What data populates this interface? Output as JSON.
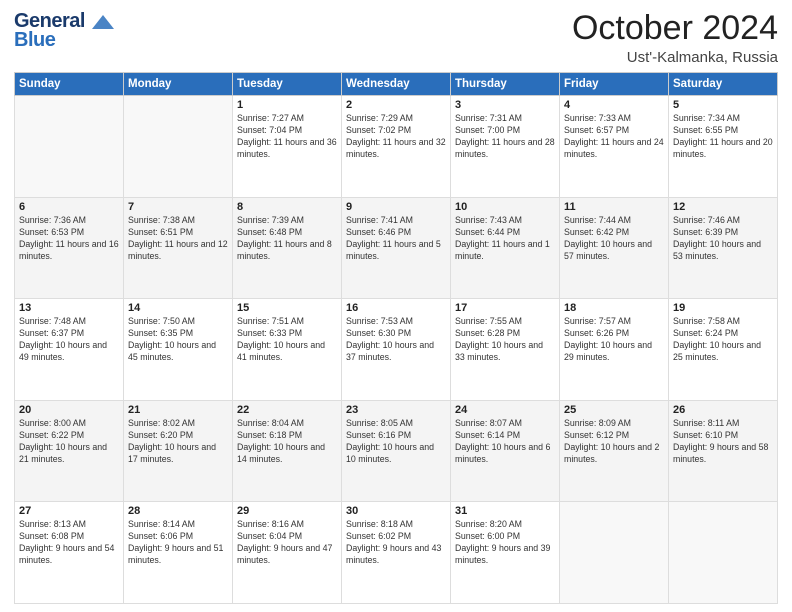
{
  "logo": {
    "line1": "General",
    "line2": "Blue"
  },
  "title": "October 2024",
  "location": "Ust'-Kalmanka, Russia",
  "days_of_week": [
    "Sunday",
    "Monday",
    "Tuesday",
    "Wednesday",
    "Thursday",
    "Friday",
    "Saturday"
  ],
  "weeks": [
    [
      {
        "day": "",
        "empty": true
      },
      {
        "day": "",
        "empty": true
      },
      {
        "day": "1",
        "sunrise": "Sunrise: 7:27 AM",
        "sunset": "Sunset: 7:04 PM",
        "daylight": "Daylight: 11 hours and 36 minutes."
      },
      {
        "day": "2",
        "sunrise": "Sunrise: 7:29 AM",
        "sunset": "Sunset: 7:02 PM",
        "daylight": "Daylight: 11 hours and 32 minutes."
      },
      {
        "day": "3",
        "sunrise": "Sunrise: 7:31 AM",
        "sunset": "Sunset: 7:00 PM",
        "daylight": "Daylight: 11 hours and 28 minutes."
      },
      {
        "day": "4",
        "sunrise": "Sunrise: 7:33 AM",
        "sunset": "Sunset: 6:57 PM",
        "daylight": "Daylight: 11 hours and 24 minutes."
      },
      {
        "day": "5",
        "sunrise": "Sunrise: 7:34 AM",
        "sunset": "Sunset: 6:55 PM",
        "daylight": "Daylight: 11 hours and 20 minutes."
      }
    ],
    [
      {
        "day": "6",
        "sunrise": "Sunrise: 7:36 AM",
        "sunset": "Sunset: 6:53 PM",
        "daylight": "Daylight: 11 hours and 16 minutes."
      },
      {
        "day": "7",
        "sunrise": "Sunrise: 7:38 AM",
        "sunset": "Sunset: 6:51 PM",
        "daylight": "Daylight: 11 hours and 12 minutes."
      },
      {
        "day": "8",
        "sunrise": "Sunrise: 7:39 AM",
        "sunset": "Sunset: 6:48 PM",
        "daylight": "Daylight: 11 hours and 8 minutes."
      },
      {
        "day": "9",
        "sunrise": "Sunrise: 7:41 AM",
        "sunset": "Sunset: 6:46 PM",
        "daylight": "Daylight: 11 hours and 5 minutes."
      },
      {
        "day": "10",
        "sunrise": "Sunrise: 7:43 AM",
        "sunset": "Sunset: 6:44 PM",
        "daylight": "Daylight: 11 hours and 1 minute."
      },
      {
        "day": "11",
        "sunrise": "Sunrise: 7:44 AM",
        "sunset": "Sunset: 6:42 PM",
        "daylight": "Daylight: 10 hours and 57 minutes."
      },
      {
        "day": "12",
        "sunrise": "Sunrise: 7:46 AM",
        "sunset": "Sunset: 6:39 PM",
        "daylight": "Daylight: 10 hours and 53 minutes."
      }
    ],
    [
      {
        "day": "13",
        "sunrise": "Sunrise: 7:48 AM",
        "sunset": "Sunset: 6:37 PM",
        "daylight": "Daylight: 10 hours and 49 minutes."
      },
      {
        "day": "14",
        "sunrise": "Sunrise: 7:50 AM",
        "sunset": "Sunset: 6:35 PM",
        "daylight": "Daylight: 10 hours and 45 minutes."
      },
      {
        "day": "15",
        "sunrise": "Sunrise: 7:51 AM",
        "sunset": "Sunset: 6:33 PM",
        "daylight": "Daylight: 10 hours and 41 minutes."
      },
      {
        "day": "16",
        "sunrise": "Sunrise: 7:53 AM",
        "sunset": "Sunset: 6:30 PM",
        "daylight": "Daylight: 10 hours and 37 minutes."
      },
      {
        "day": "17",
        "sunrise": "Sunrise: 7:55 AM",
        "sunset": "Sunset: 6:28 PM",
        "daylight": "Daylight: 10 hours and 33 minutes."
      },
      {
        "day": "18",
        "sunrise": "Sunrise: 7:57 AM",
        "sunset": "Sunset: 6:26 PM",
        "daylight": "Daylight: 10 hours and 29 minutes."
      },
      {
        "day": "19",
        "sunrise": "Sunrise: 7:58 AM",
        "sunset": "Sunset: 6:24 PM",
        "daylight": "Daylight: 10 hours and 25 minutes."
      }
    ],
    [
      {
        "day": "20",
        "sunrise": "Sunrise: 8:00 AM",
        "sunset": "Sunset: 6:22 PM",
        "daylight": "Daylight: 10 hours and 21 minutes."
      },
      {
        "day": "21",
        "sunrise": "Sunrise: 8:02 AM",
        "sunset": "Sunset: 6:20 PM",
        "daylight": "Daylight: 10 hours and 17 minutes."
      },
      {
        "day": "22",
        "sunrise": "Sunrise: 8:04 AM",
        "sunset": "Sunset: 6:18 PM",
        "daylight": "Daylight: 10 hours and 14 minutes."
      },
      {
        "day": "23",
        "sunrise": "Sunrise: 8:05 AM",
        "sunset": "Sunset: 6:16 PM",
        "daylight": "Daylight: 10 hours and 10 minutes."
      },
      {
        "day": "24",
        "sunrise": "Sunrise: 8:07 AM",
        "sunset": "Sunset: 6:14 PM",
        "daylight": "Daylight: 10 hours and 6 minutes."
      },
      {
        "day": "25",
        "sunrise": "Sunrise: 8:09 AM",
        "sunset": "Sunset: 6:12 PM",
        "daylight": "Daylight: 10 hours and 2 minutes."
      },
      {
        "day": "26",
        "sunrise": "Sunrise: 8:11 AM",
        "sunset": "Sunset: 6:10 PM",
        "daylight": "Daylight: 9 hours and 58 minutes."
      }
    ],
    [
      {
        "day": "27",
        "sunrise": "Sunrise: 8:13 AM",
        "sunset": "Sunset: 6:08 PM",
        "daylight": "Daylight: 9 hours and 54 minutes."
      },
      {
        "day": "28",
        "sunrise": "Sunrise: 8:14 AM",
        "sunset": "Sunset: 6:06 PM",
        "daylight": "Daylight: 9 hours and 51 minutes."
      },
      {
        "day": "29",
        "sunrise": "Sunrise: 8:16 AM",
        "sunset": "Sunset: 6:04 PM",
        "daylight": "Daylight: 9 hours and 47 minutes."
      },
      {
        "day": "30",
        "sunrise": "Sunrise: 8:18 AM",
        "sunset": "Sunset: 6:02 PM",
        "daylight": "Daylight: 9 hours and 43 minutes."
      },
      {
        "day": "31",
        "sunrise": "Sunrise: 8:20 AM",
        "sunset": "Sunset: 6:00 PM",
        "daylight": "Daylight: 9 hours and 39 minutes."
      },
      {
        "day": "",
        "empty": true
      },
      {
        "day": "",
        "empty": true
      }
    ]
  ]
}
